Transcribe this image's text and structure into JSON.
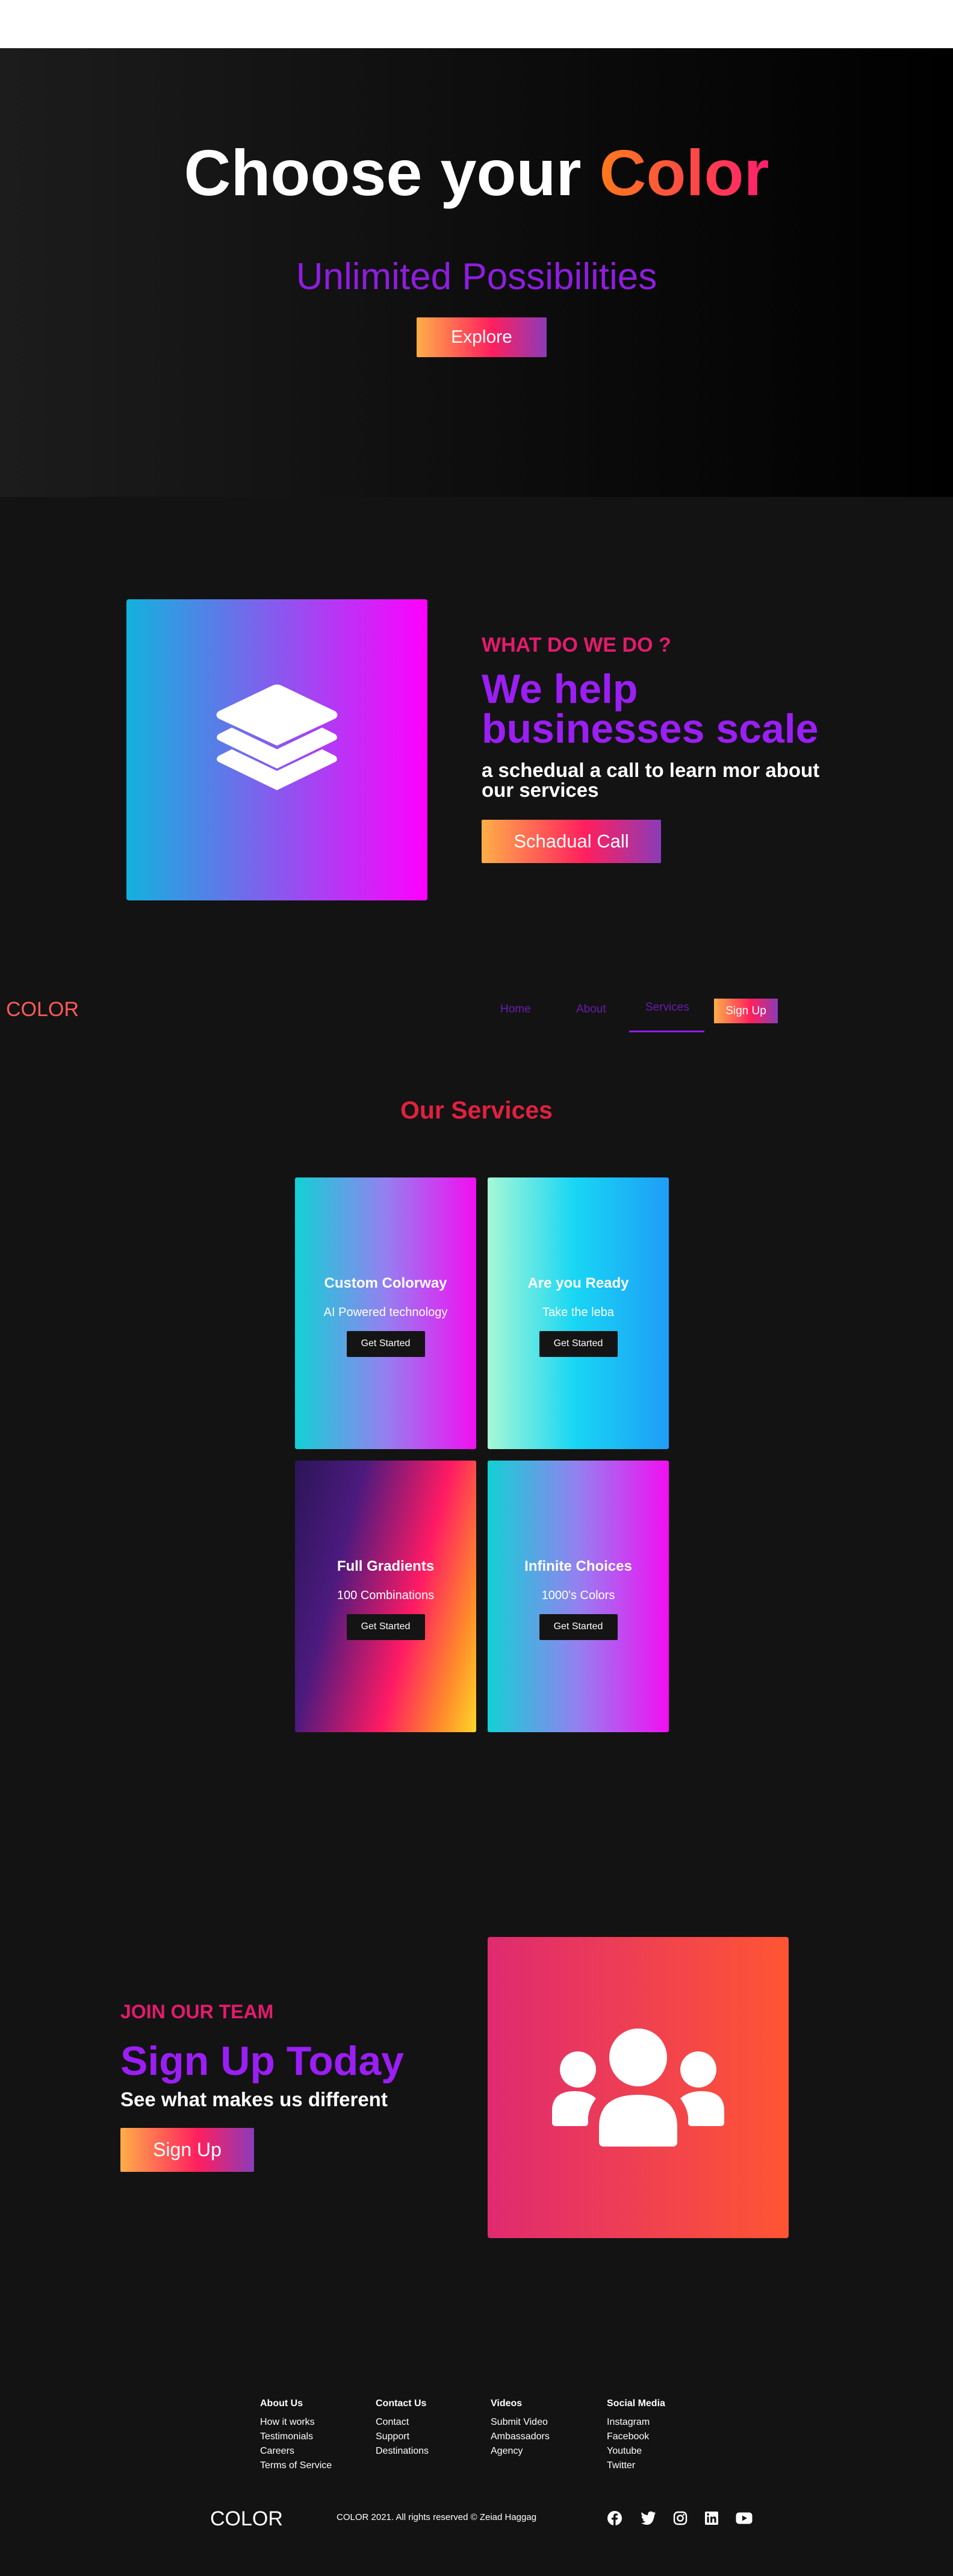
{
  "hero": {
    "title_part1": "Choose your ",
    "title_accent": "Color",
    "subtitle": "Unlimited Possibilities",
    "explore_label": "Explore"
  },
  "what_we_do": {
    "label": "WHAT DO WE DO ?",
    "title": "We help businesses scale",
    "description": "a schedual a call to learn mor about our services",
    "button_label": "Schadual Call",
    "icon": "layers-icon"
  },
  "nav": {
    "logo": "COLOR",
    "links": [
      "Home",
      "About",
      "Services"
    ],
    "active": "Services",
    "signup_label": "Sign Up"
  },
  "services": {
    "title": "Our Services",
    "cards": [
      {
        "title": "Custom Colorway",
        "subtitle": "AI Powered technology",
        "button": "Get Started"
      },
      {
        "title": "Are you Ready",
        "subtitle": "Take the leba",
        "button": "Get Started"
      },
      {
        "title": "Full Gradients",
        "subtitle": "100 Combinations",
        "button": "Get Started"
      },
      {
        "title": "Infinite Choices",
        "subtitle": "1000's Colors",
        "button": "Get Started"
      }
    ]
  },
  "join": {
    "label": "JOIN OUR TEAM",
    "title": "Sign Up Today",
    "description": "See what makes us different",
    "button_label": "Sign Up",
    "icon": "users-icon"
  },
  "footer": {
    "columns": [
      {
        "title": "About Us",
        "links": [
          "How it works",
          "Testimonials",
          "Careers",
          "Terms of Service"
        ]
      },
      {
        "title": "Contact Us",
        "links": [
          "Contact",
          "Support",
          "Destinations"
        ]
      },
      {
        "title": "Videos",
        "links": [
          "Submit Video",
          "Ambassadors",
          "Agency"
        ]
      },
      {
        "title": "Social Media",
        "links": [
          "Instagram",
          "Facebook",
          "Youtube",
          "Twitter"
        ]
      }
    ],
    "logo": "COLOR",
    "copyright": "COLOR 2021. All rights reserved © Zeiad Haggag",
    "social_icons": [
      "facebook-icon",
      "twitter-icon",
      "instagram-icon",
      "linkedin-icon",
      "youtube-icon"
    ]
  },
  "colors": {
    "accent_pink": "#e31b6d",
    "accent_purple": "#9b1ef5",
    "background": "#131313"
  }
}
